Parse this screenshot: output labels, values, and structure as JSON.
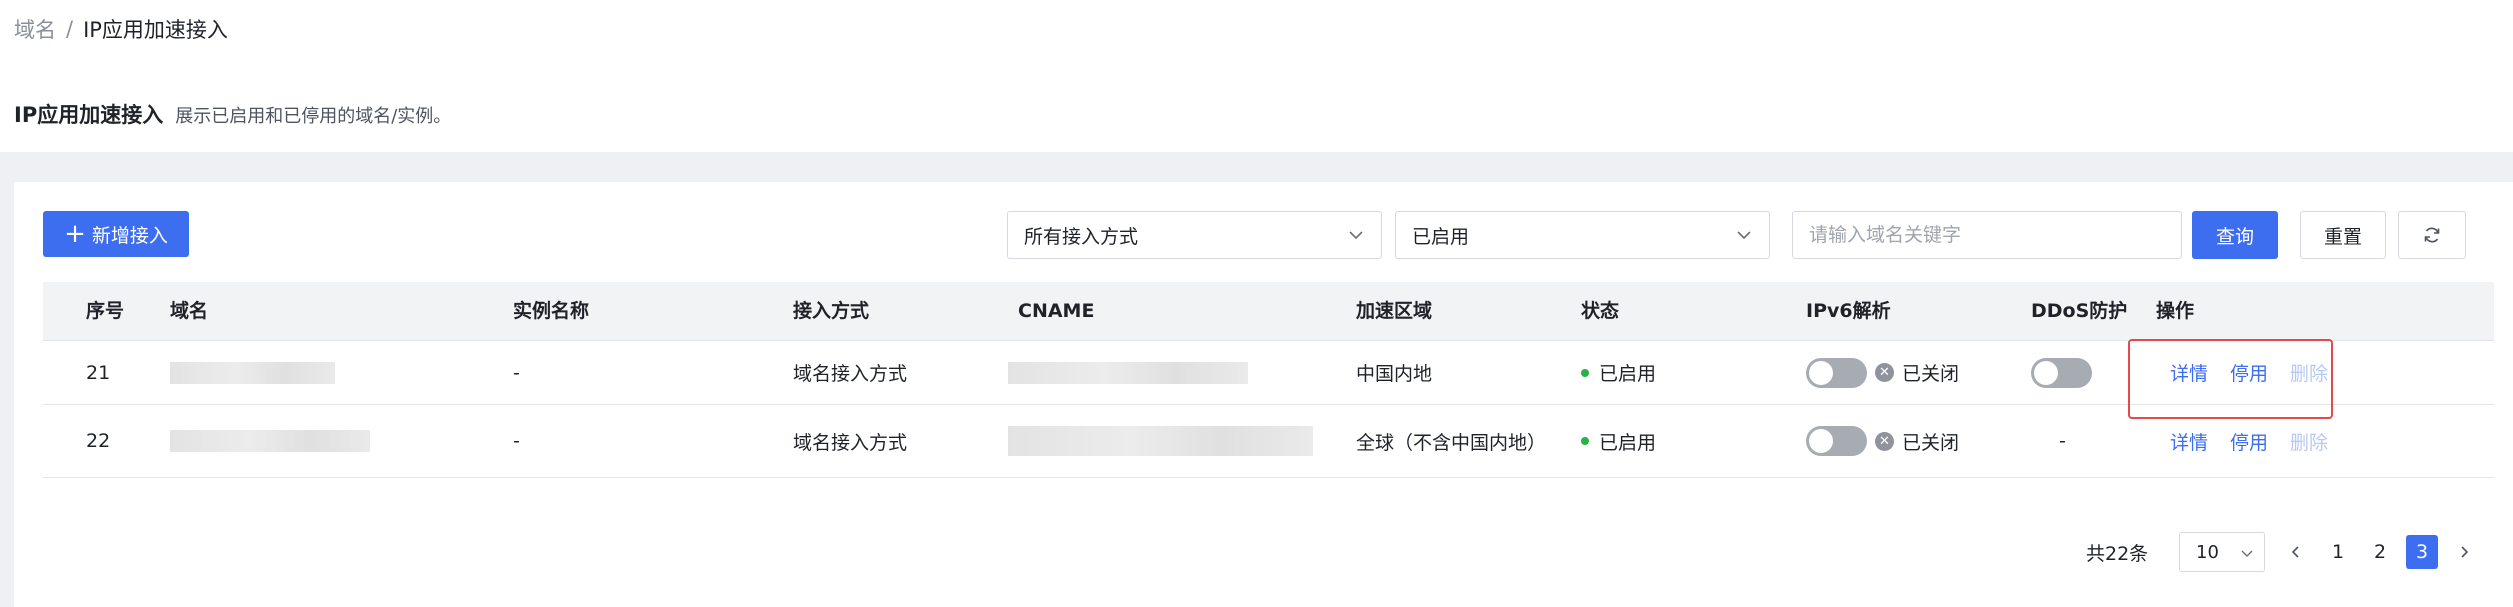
{
  "breadcrumb": {
    "parent": "域名",
    "separator": "/",
    "current": "IP应用加速接入"
  },
  "header": {
    "title": "IP应用加速接入",
    "description": "展示已启用和已停用的域名/实例。"
  },
  "toolbar": {
    "add_label": "新增接入",
    "mode_select": "所有接入方式",
    "status_select": "已启用",
    "search_placeholder": "请输入域名关键字",
    "query_label": "查询",
    "reset_label": "重置"
  },
  "table": {
    "columns": [
      "序号",
      "域名",
      "实例名称",
      "接入方式",
      "CNAME",
      "加速区域",
      "状态",
      "IPv6解析",
      "DDoS防护",
      "操作"
    ],
    "rows": [
      {
        "index": "21",
        "instance": "-",
        "mode": "域名接入方式",
        "region": "中国内地",
        "status": "已启用",
        "ipv6": "已关闭",
        "ddos": "",
        "actions": [
          "详情",
          "停用",
          "删除"
        ]
      },
      {
        "index": "22",
        "instance": "-",
        "mode": "域名接入方式",
        "region": "全球（不含中国内地）",
        "status": "已启用",
        "ipv6": "已关闭",
        "ddos": "-",
        "actions": [
          "详情",
          "停用",
          "删除"
        ]
      }
    ]
  },
  "pagination": {
    "total": "共22条",
    "page_size": "10",
    "pages": [
      "1",
      "2",
      "3"
    ],
    "current": "3"
  },
  "colors": {
    "primary": "#3d6ef0",
    "success": "#27b148",
    "highlight": "#e5484d"
  }
}
